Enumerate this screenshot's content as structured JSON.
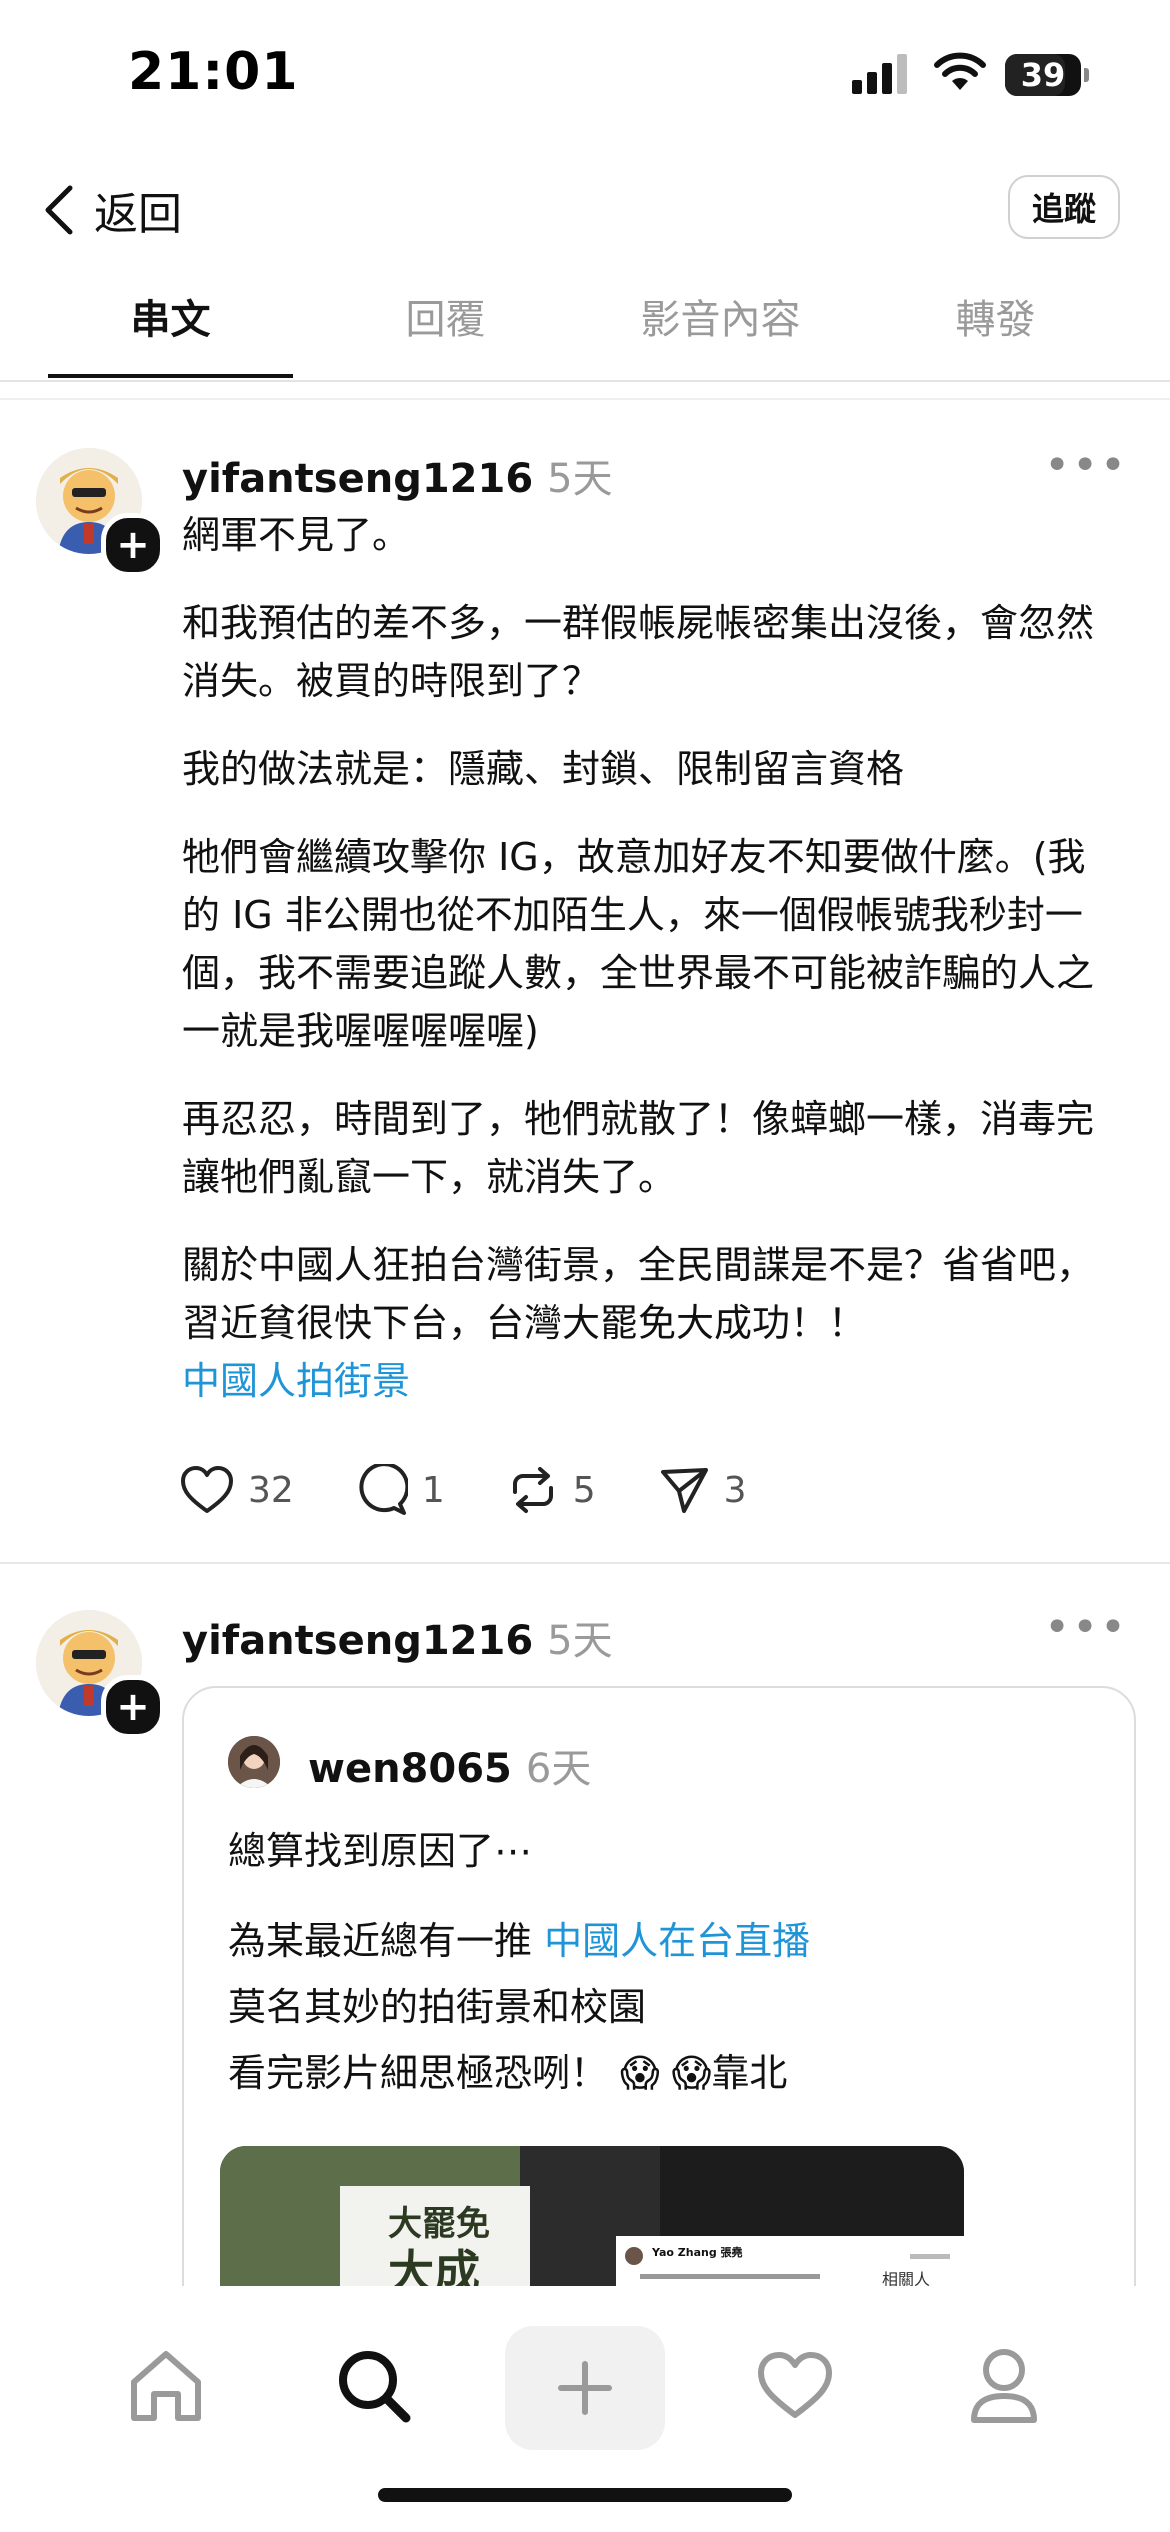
{
  "status_bar": {
    "time": "21:01",
    "battery": "39"
  },
  "nav": {
    "back_label": "返回",
    "follow_label": "追蹤"
  },
  "tabs": [
    {
      "label": "串文",
      "active": true
    },
    {
      "label": "回覆"
    },
    {
      "label": "影音內容"
    },
    {
      "label": "轉發"
    }
  ],
  "post1": {
    "username": "yifantseng1216",
    "time": "5天",
    "paragraphs": [
      "網軍不見了。",
      "和我預估的差不多，一群假帳屍帳密集出沒後，會忽然消失。被買的時限到了？",
      "我的做法就是：隱藏、封鎖、限制留言資格",
      "牠們會繼續攻擊你 IG，故意加好友不知要做什麼。(我的 IG 非公開也從不加陌生人，來一個假帳號我秒封一個，我不需要追蹤人數，全世界最不可能被詐騙的人之一就是我喔喔喔喔喔)",
      "再忍忍，時間到了，牠們就散了！像蟑螂一樣，消毒完讓牠們亂竄一下，就消失了。",
      "關於中國人狂拍台灣街景，全民間諜是不是？省省吧，習近貧很快下台，台灣大罷免大成功！！"
    ],
    "hashtag": "中國人拍街景",
    "likes": "32",
    "replies": "1",
    "reposts": "5",
    "shares": "3"
  },
  "post2": {
    "username": "yifantseng1216",
    "time": "5天",
    "quote": {
      "username": "wen8065",
      "time": "6天",
      "line1": "總算找到原因了⋯",
      "line2_prefix": "為某最近總有一推 ",
      "line2_hashtag": "中國人在台直播",
      "line3": "莫名其妙的拍街景和校園",
      "line4_text": "看完影片細思極恐咧！",
      "line4_emoji": "😱 😱",
      "line4_suffix": "靠北",
      "image_sign_line1": "大罷免",
      "image_sign_line2": "大成",
      "image_tweet_name": "Yao Zhang 張堯",
      "image_side_label": "相關人"
    }
  },
  "tabbar": [
    "home-icon",
    "search-icon",
    "create-icon",
    "heart-icon",
    "profile-icon"
  ]
}
